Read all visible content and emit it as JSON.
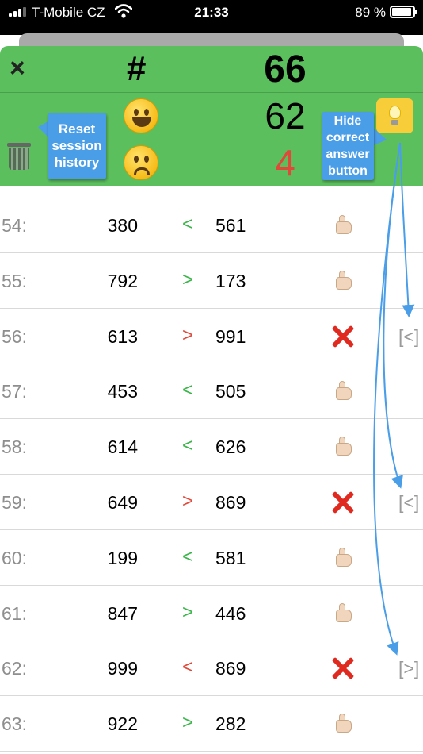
{
  "status_bar": {
    "carrier": "T-Mobile CZ",
    "time": "21:33",
    "battery": "89 %"
  },
  "header": {
    "close_glyph": "×",
    "hash_label": "#",
    "total": "66",
    "correct_count": "62",
    "wrong_count": "4",
    "icons": [
      "close-icon",
      "smiley-happy-icon",
      "smiley-sad-icon",
      "trash-icon",
      "lightbulb-icon"
    ]
  },
  "callouts": {
    "reset": "Reset session history",
    "hide": "Hide correct answer button"
  },
  "colors": {
    "header_green": "#5cbf5e",
    "callout_blue": "#4a9ee8",
    "op_green": "#3bb54a",
    "op_red": "#e0483a",
    "bulb_yellow": "#f7cd3a"
  },
  "rows": [
    {
      "num": "54:",
      "a": "380",
      "op": "<",
      "b": "561",
      "result": "thumbs-up",
      "correction": ""
    },
    {
      "num": "55:",
      "a": "792",
      "op": ">",
      "b": "173",
      "result": "thumbs-up",
      "correction": ""
    },
    {
      "num": "56:",
      "a": "613",
      "op": ">",
      "b": "991",
      "result": "cross",
      "correction": "[<]"
    },
    {
      "num": "57:",
      "a": "453",
      "op": "<",
      "b": "505",
      "result": "thumbs-up",
      "correction": ""
    },
    {
      "num": "58:",
      "a": "614",
      "op": "<",
      "b": "626",
      "result": "thumbs-up",
      "correction": ""
    },
    {
      "num": "59:",
      "a": "649",
      "op": ">",
      "b": "869",
      "result": "cross",
      "correction": "[<]"
    },
    {
      "num": "60:",
      "a": "199",
      "op": "<",
      "b": "581",
      "result": "thumbs-up",
      "correction": ""
    },
    {
      "num": "61:",
      "a": "847",
      "op": ">",
      "b": "446",
      "result": "thumbs-up",
      "correction": ""
    },
    {
      "num": "62:",
      "a": "999",
      "op": "<",
      "b": "869",
      "result": "cross",
      "correction": "[>]"
    },
    {
      "num": "63:",
      "a": "922",
      "op": ">",
      "b": "282",
      "result": "thumbs-up",
      "correction": ""
    }
  ]
}
